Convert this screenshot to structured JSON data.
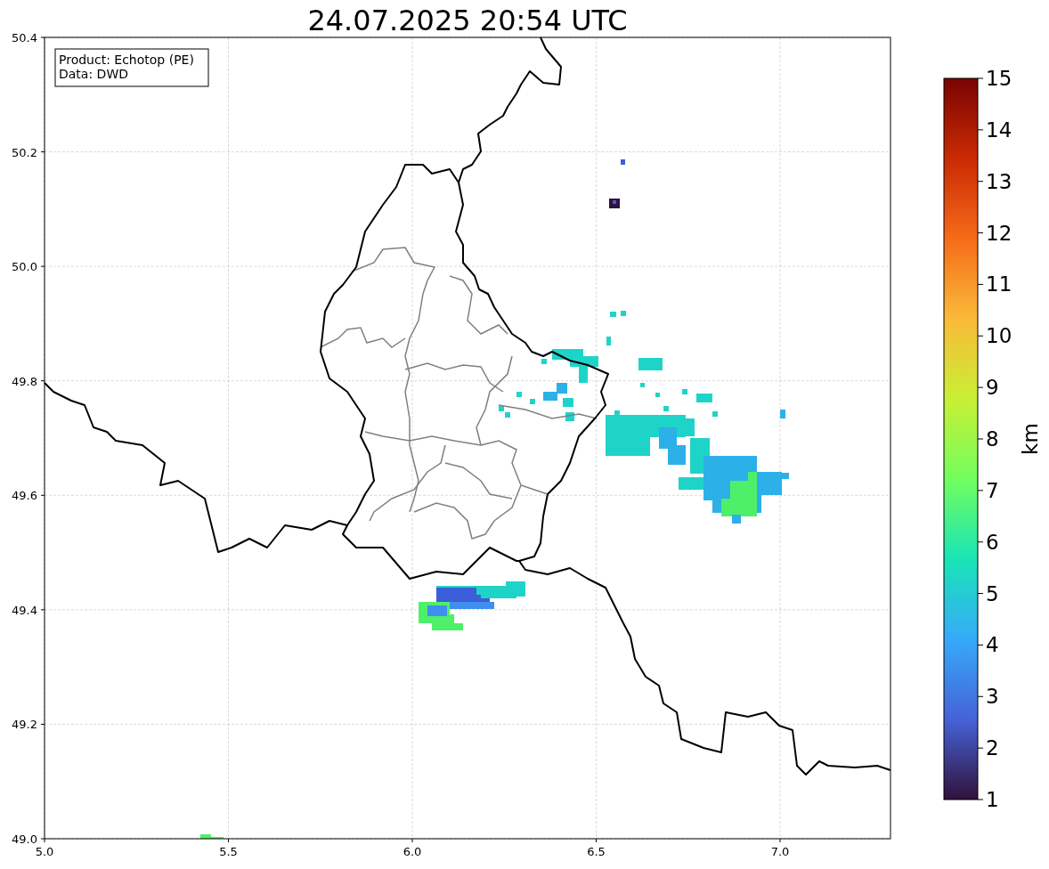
{
  "title": "24.07.2025 20:54 UTC",
  "info_box": [
    "Product: Echotop (PE)",
    "Data: DWD"
  ],
  "map": {
    "xticks": [
      "5.0",
      "5.5",
      "6.0",
      "6.5",
      "7.0"
    ],
    "yticks": [
      "50.4",
      "50.2",
      "50.0",
      "49.8",
      "49.6",
      "49.4",
      "49.2",
      "49.0"
    ]
  },
  "colorbar": {
    "label": "km",
    "ticks": [
      "15",
      "14",
      "13",
      "12",
      "11",
      "10",
      "9",
      "8",
      "7",
      "6",
      "5",
      "4",
      "3",
      "2",
      "1"
    ]
  }
}
